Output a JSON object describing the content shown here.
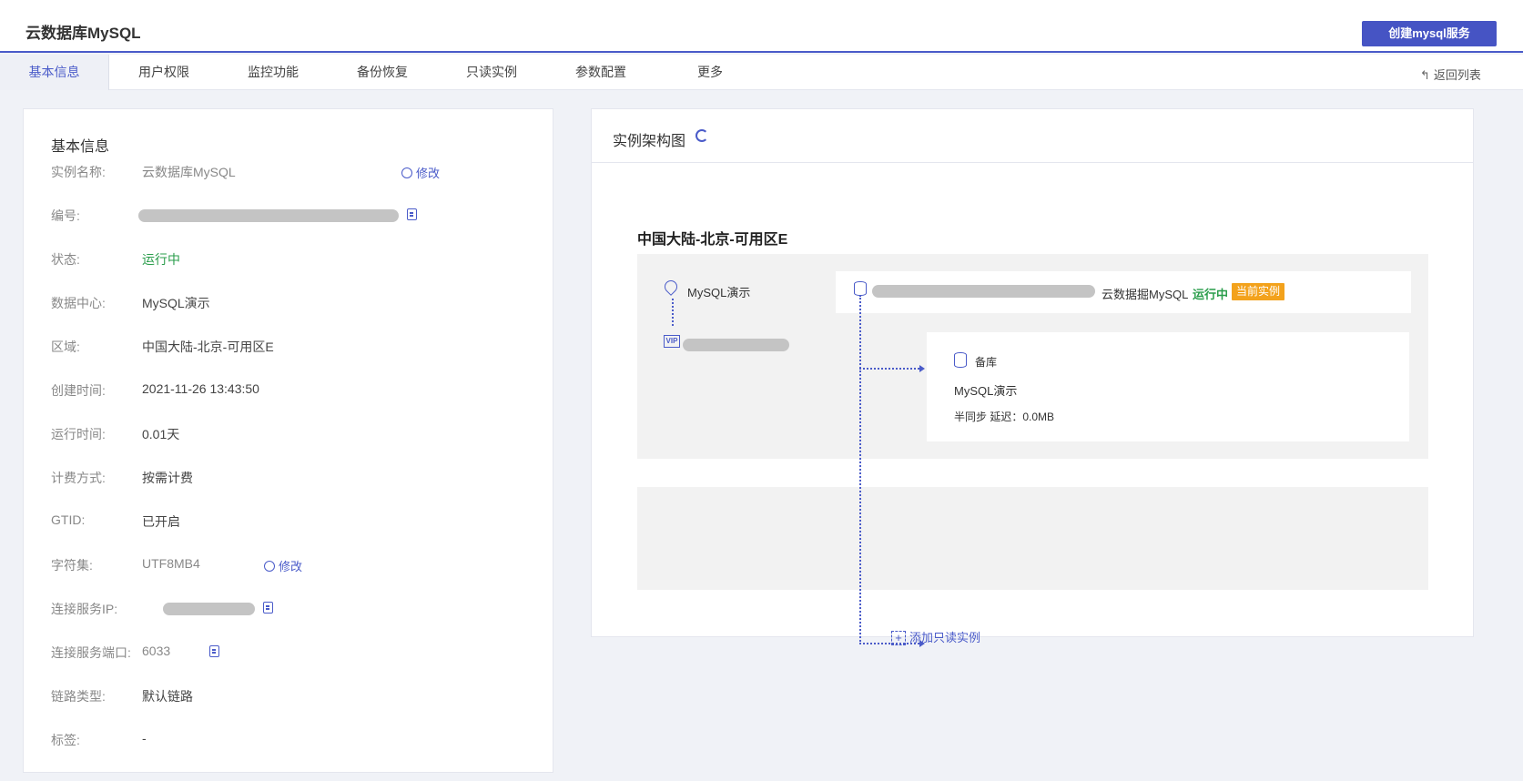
{
  "header": {
    "title": "云数据库MySQL",
    "create_button": "创建mysql服务"
  },
  "tabs": [
    {
      "label": "基本信息",
      "active": true
    },
    {
      "label": "用户权限"
    },
    {
      "label": "监控功能"
    },
    {
      "label": "备份恢复"
    },
    {
      "label": "只读实例"
    },
    {
      "label": "参数配置"
    },
    {
      "label": "更多"
    }
  ],
  "back_link": "返回列表",
  "basic_info": {
    "title": "基本信息",
    "edit_label": "修改",
    "rows": {
      "name": {
        "label": "实例名称:",
        "value": "云数据库MySQL"
      },
      "id": {
        "label": "编号:"
      },
      "status": {
        "label": "状态:",
        "value": "运行中"
      },
      "datacenter": {
        "label": "数据中心:",
        "value": "MySQL演示"
      },
      "region": {
        "label": "区域:",
        "value": "中国大陆-北京-可用区E"
      },
      "created": {
        "label": "创建时间:",
        "value": "2021-11-26 13:43:50"
      },
      "uptime": {
        "label": "运行时间:",
        "value": "0.01天"
      },
      "billing": {
        "label": "计费方式:",
        "value": "按需计费"
      },
      "gtid": {
        "label": "GTID:",
        "value": "已开启"
      },
      "charset": {
        "label": "字符集:",
        "value": "UTF8MB4"
      },
      "ip": {
        "label": "连接服务IP:"
      },
      "port": {
        "label": "连接服务端口:",
        "value": "6033"
      },
      "link": {
        "label": "链路类型:",
        "value": "默认链路"
      },
      "tags": {
        "label": "标签:",
        "value": "-"
      }
    }
  },
  "architecture": {
    "title": "实例架构图",
    "zone": "中国大陆-北京-可用区E",
    "datacenter": "MySQL演示",
    "master": {
      "name": "云数据掘MySQL",
      "status": "运行中",
      "badge": "当前实例"
    },
    "backup": {
      "title": "备库",
      "name": "MySQL演示",
      "sync": "半同步 延迟：0.0MB"
    },
    "add_readonly": "添加只读实例"
  },
  "colors": {
    "accent": "#4a5bc9",
    "running": "#2a9d4b",
    "badge": "#f3a21c",
    "redacted": "#c4c4c4"
  }
}
